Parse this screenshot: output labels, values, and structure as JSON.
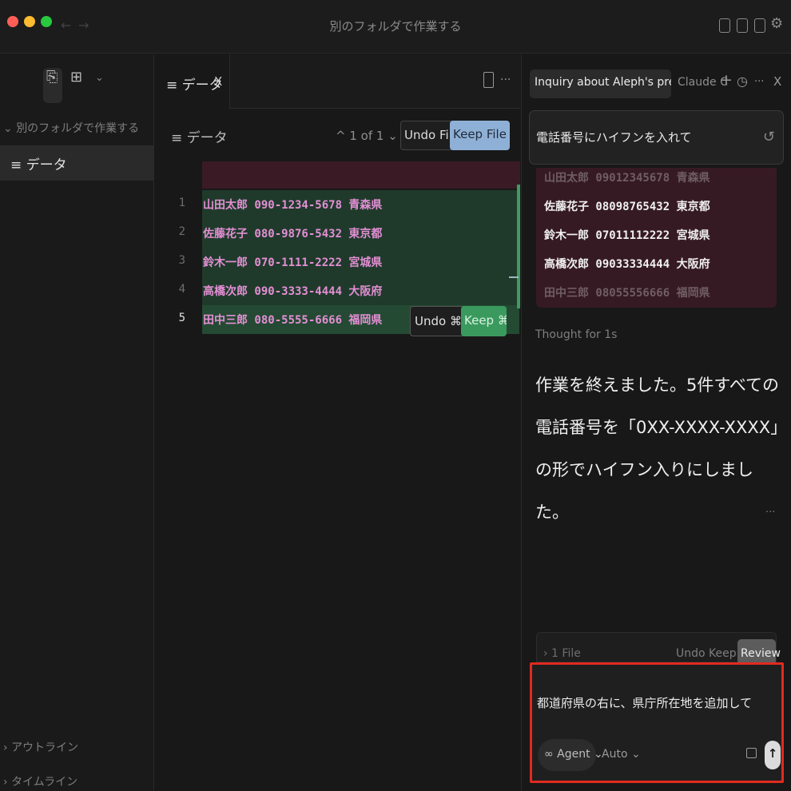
{
  "window": {
    "title": "別のフォルダで作業する",
    "back_icon": "←",
    "forward_icon": "→"
  },
  "sidebar": {
    "folder_label": "別のフォルダで作業する",
    "file_label": "データ",
    "outline_label": "アウトライン",
    "timeline_label": "タイムライン"
  },
  "editor": {
    "tab_label": "データ",
    "tab_close": "X",
    "more_icon": "···",
    "breadcrumb": "データ",
    "diff_position": "1 of 1",
    "undo_file": "Undo File",
    "keep_file": "Keep File ⌘⏎",
    "lines": [
      {
        "num": "1",
        "text": "山田太郎 090-1234-5678 青森県"
      },
      {
        "num": "2",
        "text": "佐藤花子 080-9876-5432 東京都"
      },
      {
        "num": "3",
        "text": "鈴木一郎 070-1111-2222 宮城県"
      },
      {
        "num": "4",
        "text": "高橋次郎 090-3333-4444 大阪府"
      },
      {
        "num": "5",
        "text": "田中三郎 080-5555-6666 福岡県"
      }
    ],
    "undo_line": "Undo ⌘N",
    "keep_line": "Keep ⌘Y"
  },
  "chat": {
    "tab_active": "Inquiry about Aleph's presence",
    "tab_second": "Claude C",
    "user_message": "電話番号にハイフンを入れて",
    "diff_rows": [
      "山田太郎 09012345678 青森県",
      "佐藤花子 08098765432 東京都",
      "鈴木一郎 07011112222 宮城県",
      "高橋次郎 09033334444 大阪府",
      "田中三郎 08055556666 福岡県"
    ],
    "thought": "Thought for 1s",
    "answer": "作業を終えました。5件すべての電話番号を「0XX-XXXX-XXXX」の形でハイフン入りにしました。",
    "more_dots": "···",
    "review_files": "› 1 File",
    "review_undo": "Undo",
    "review_keep": "Keep",
    "review_review": "Review",
    "composer_text": "都道府県の右に、県庁所在地を追加して",
    "agent_label": "∞ Agent ⌄",
    "auto_label": "Auto ⌄",
    "send_icon": "↑"
  },
  "colors": {
    "highlight_border": "#e02b1f",
    "added_bg": "#1f3a2b",
    "removed_bg": "#361a23",
    "keep_file_bg": "#8fb0d6",
    "keep_line_bg": "#3a9a5e"
  }
}
